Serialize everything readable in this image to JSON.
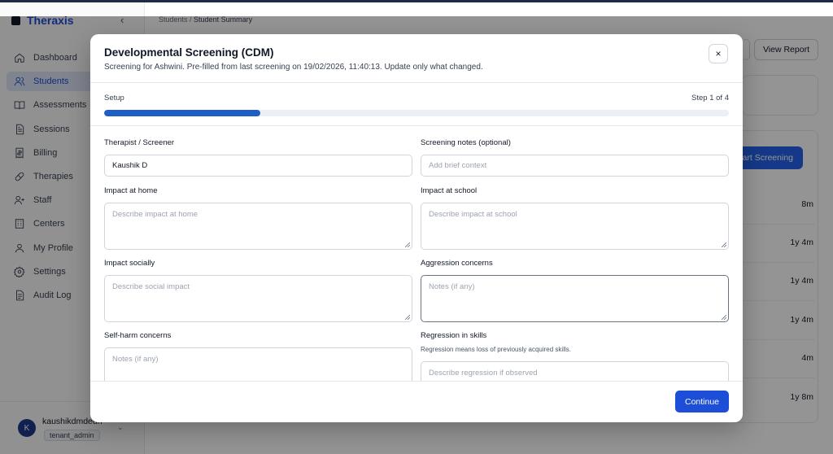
{
  "sidebar": {
    "brand": "Theraxis",
    "collapse_icon": "chevron-left-icon",
    "items": [
      {
        "label": "Dashboard",
        "icon": "home-icon",
        "active": false
      },
      {
        "label": "Students",
        "icon": "users-icon",
        "active": true
      },
      {
        "label": "Assessments",
        "icon": "book-icon",
        "active": false
      },
      {
        "label": "Sessions",
        "icon": "document-icon",
        "active": false
      },
      {
        "label": "Billing",
        "icon": "receipt-icon",
        "active": false
      },
      {
        "label": "Therapies",
        "icon": "pill-icon",
        "active": false
      },
      {
        "label": "Staff",
        "icon": "user-plus-icon",
        "active": false
      },
      {
        "label": "Centers",
        "icon": "building-icon",
        "active": false
      },
      {
        "label": "My Profile",
        "icon": "user-icon",
        "active": false
      },
      {
        "label": "Settings",
        "icon": "gear-icon",
        "active": false
      },
      {
        "label": "Audit Log",
        "icon": "log-icon",
        "active": false
      }
    ],
    "user": {
      "avatar": "K",
      "name": "kaushikdmdeun",
      "role": "tenant_admin"
    }
  },
  "breadcrumb": {
    "parent": "Students",
    "separator": " / ",
    "current": "Student Summary"
  },
  "background": {
    "view_report": "View Report",
    "start_screening": "art Screening",
    "ages": [
      "8m",
      "1y 4m",
      "1y 4m",
      "1y 4m",
      "4m",
      "1y 8m"
    ]
  },
  "modal": {
    "title": "Developmental Screening (CDM)",
    "subtitle": "Screening for Ashwini. Pre-filled from last screening on 19/02/2026, 11:40:13. Update only what changed.",
    "close_label": "×",
    "step_label": "Setup",
    "step_count": "Step 1 of 4",
    "progress_fraction": 0.25,
    "fields": {
      "therapist": {
        "label": "Therapist / Screener",
        "value": "Kaushik D",
        "placeholder": ""
      },
      "notes": {
        "label": "Screening notes (optional)",
        "value": "",
        "placeholder": "Add brief context"
      },
      "home": {
        "label": "Impact at home",
        "placeholder": "Describe impact at home"
      },
      "school": {
        "label": "Impact at school",
        "placeholder": "Describe impact at school"
      },
      "social": {
        "label": "Impact socially",
        "placeholder": "Describe social impact"
      },
      "aggression": {
        "label": "Aggression concerns",
        "placeholder": "Notes (if any)"
      },
      "selfharm": {
        "label": "Self-harm concerns",
        "placeholder": "Notes (if any)"
      },
      "regression": {
        "label": "Regression in skills",
        "help": "Regression means loss of previously acquired skills.",
        "placeholder": "Describe regression if observed"
      }
    },
    "continue_label": "Continue"
  },
  "colors": {
    "primary": "#1d4ed8",
    "progress": "#1d5fc4",
    "active_nav_bg": "#dbe4f5"
  }
}
